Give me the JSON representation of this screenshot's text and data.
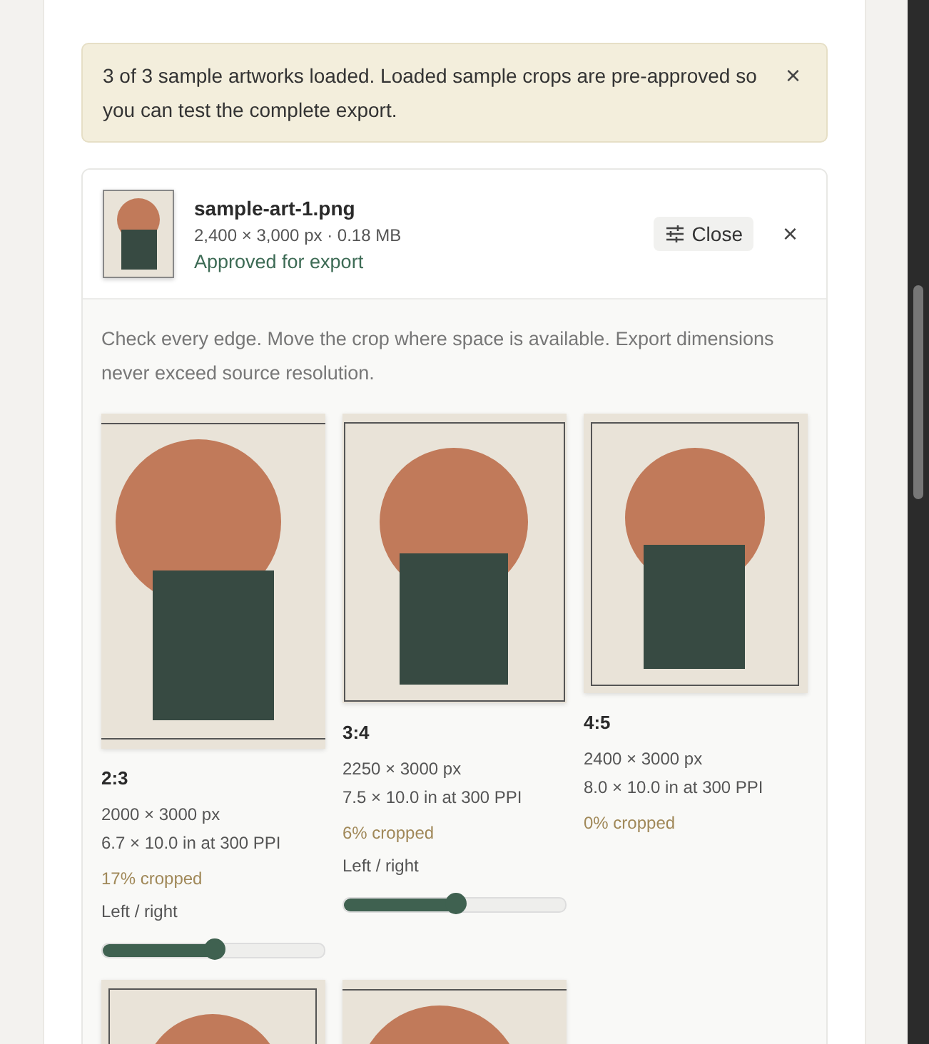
{
  "notice": {
    "text": "3 of 3 sample artworks loaded. Loaded sample crops are pre-approved so you can test the complete export.",
    "close": "×"
  },
  "file": {
    "name": "sample-art-1.png",
    "meta": "2,400 × 3,000 px · 0.18 MB",
    "status": "Approved for export",
    "close_button": "Close",
    "remove": "×",
    "hint": "Check every edge. Move the crop where space is available. Export dimensions never exceed source resolution."
  },
  "crops": [
    {
      "kind": "lines",
      "ratio": "2:3",
      "size": "2000 × 3000 px",
      "print": "6.7 × 10.0 in at 300 PPI",
      "cropped": "17% cropped",
      "slider_label": "Left / right",
      "level": 0.5
    },
    {
      "kind": "box",
      "ratio": "3:4",
      "size": "2250 × 3000 px",
      "print": "7.5 × 10.0 in at 300 PPI",
      "cropped": "6% cropped",
      "slider_label": "Left / right",
      "level": 0.5
    },
    {
      "kind": "inset",
      "ratio": "4:5",
      "size": "2400 × 3000 px",
      "print": "8.0 × 10.0 in at 300 PPI",
      "cropped": "0% cropped"
    },
    {
      "kind": "inset"
    },
    {
      "kind": "lines"
    }
  ]
}
